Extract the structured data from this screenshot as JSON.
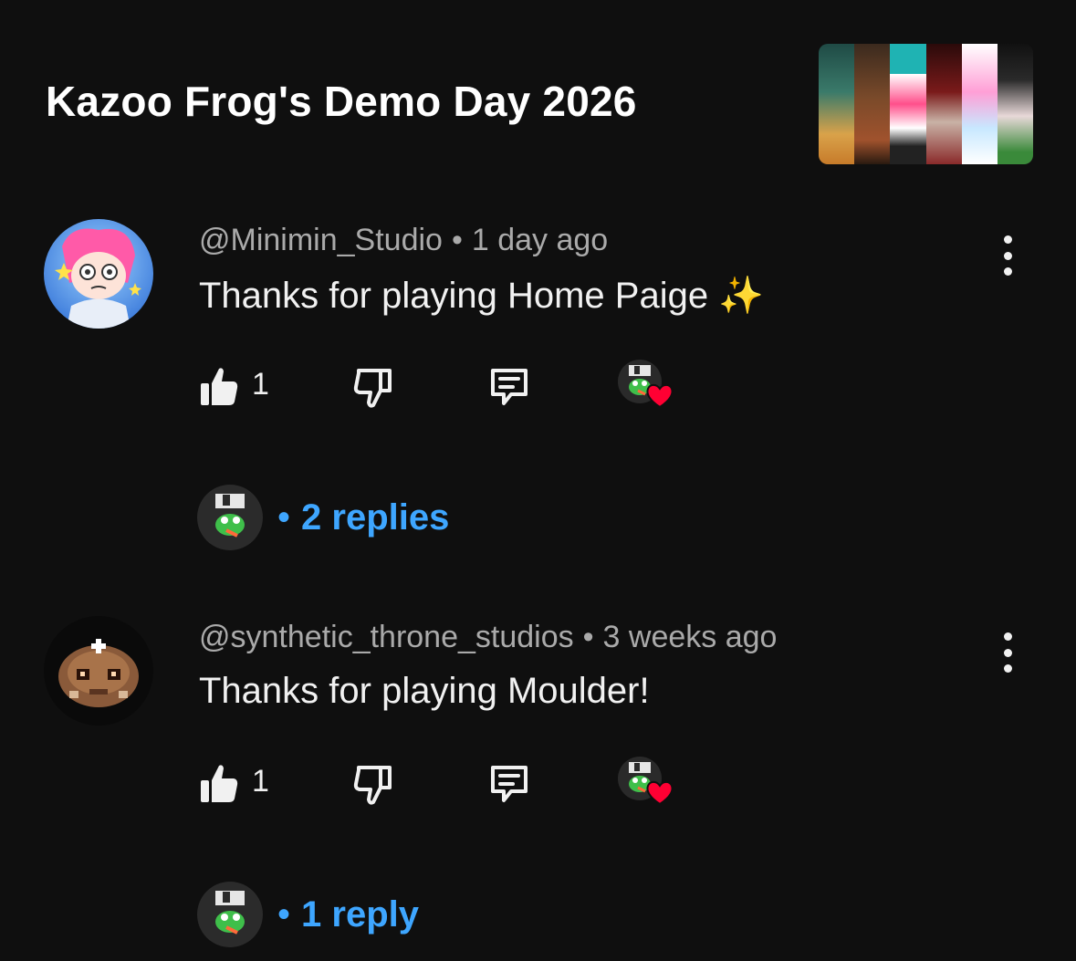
{
  "header": {
    "title": "Kazoo Frog's Demo Day 2026",
    "thumbnail_icon": "video-thumbnail-collage"
  },
  "colors": {
    "background": "#0f0f0f",
    "text_primary": "#f1f1f1",
    "text_secondary": "#aaaaaa",
    "link_blue": "#3ea6ff",
    "heart_red": "#ff0033"
  },
  "comments": [
    {
      "author": "@Minimin_Studio",
      "separator": "•",
      "time": "1 day ago",
      "text": "Thanks for playing Home Paige ✨",
      "like_count": "1",
      "avatar_icon": "pink-haired-character-avatar",
      "hearted_by_creator": true,
      "replies_label": "2 replies",
      "replies_bullet": "•"
    },
    {
      "author": "@synthetic_throne_studios",
      "separator": "•",
      "time": "3 weeks ago",
      "text": "Thanks for playing Moulder!",
      "like_count": "1",
      "avatar_icon": "pixel-art-creature-avatar",
      "hearted_by_creator": true,
      "replies_label": "1 reply",
      "replies_bullet": "•"
    }
  ],
  "icons": {
    "like": "thumbs-up-icon",
    "dislike": "thumbs-down-icon",
    "reply": "comment-icon",
    "more": "more-vertical-icon",
    "creator_heart": "creator-heart-icon"
  }
}
